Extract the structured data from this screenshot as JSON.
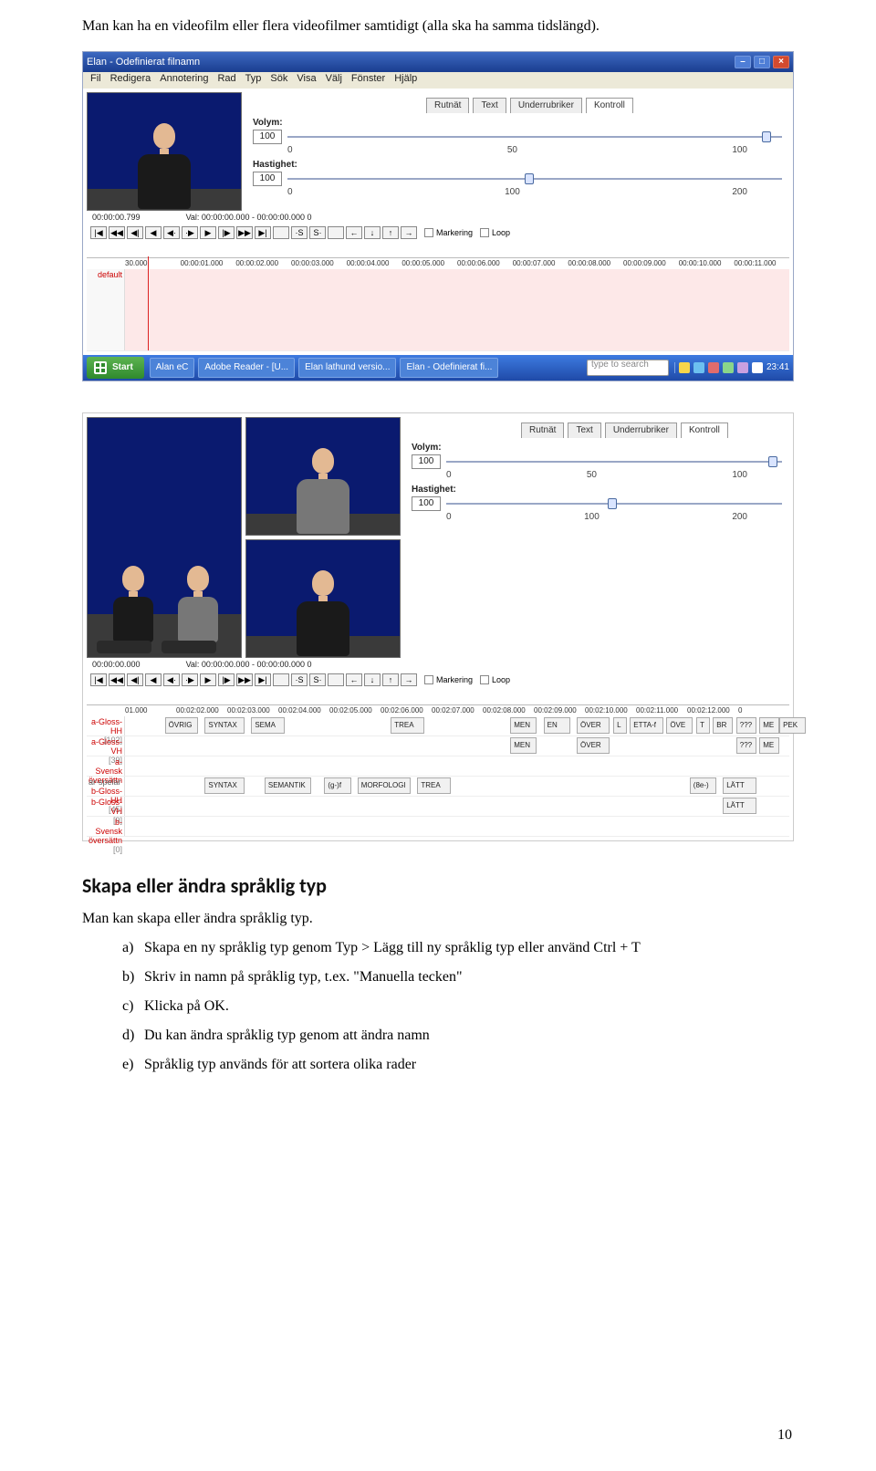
{
  "introText": "Man kan ha en videofilm eller flera videofilmer samtidigt (alla ska ha samma tidslängd).",
  "app1": {
    "title": "Elan - Odefinierat filnamn",
    "menu": [
      "Fil",
      "Redigera",
      "Annotering",
      "Rad",
      "Typ",
      "Sök",
      "Visa",
      "Välj",
      "Fönster",
      "Hjälp"
    ],
    "tabs": [
      "Rutnät",
      "Text",
      "Underrubriker",
      "Kontroll"
    ],
    "volume": {
      "label": "Volym:",
      "value": "100",
      "ticks": [
        "0",
        "50",
        "100"
      ]
    },
    "speed": {
      "label": "Hastighet:",
      "value": "100",
      "ticks": [
        "0",
        "100",
        "200"
      ]
    },
    "timecodeLeft": "00:00:00.799",
    "timecodeRight": "Val: 00:00:00.000 - 00:00:00.000  0",
    "markering": "Markering",
    "loop": "Loop",
    "ruler": [
      "30.000",
      "00:00:01.000",
      "00:00:02.000",
      "00:00:03.000",
      "00:00:04.000",
      "00:00:05.000",
      "00:00:06.000",
      "00:00:07.000",
      "00:00:08.000",
      "00:00:09.000",
      "00:00:10.000",
      "00:00:11.000"
    ],
    "laneLabel": "default"
  },
  "taskbar": {
    "start": "Start",
    "items": [
      "Alan eC",
      "Adobe Reader - [U...",
      "Elan lathund versio...",
      "Elan - Odefinierat fi..."
    ],
    "searchPlaceholder": "type to search",
    "clock": "23:41"
  },
  "app2": {
    "tabs": [
      "Rutnät",
      "Text",
      "Underrubriker",
      "Kontroll"
    ],
    "volume": {
      "label": "Volym:",
      "value": "100",
      "ticks": [
        "0",
        "50",
        "100"
      ]
    },
    "speed": {
      "label": "Hastighet:",
      "value": "100",
      "ticks": [
        "0",
        "100",
        "200"
      ]
    },
    "timecodeLeft": "00:00:00.000",
    "timecodeRight": "Val: 00:00:00.000 - 00:00:00.000  0",
    "markering": "Markering",
    "loop": "Loop",
    "ruler": [
      "01.000",
      "00:02:02.000",
      "00:02:03.000",
      "00:02:04.000",
      "00:02:05.000",
      "00:02:06.000",
      "00:02:07.000",
      "00:02:08.000",
      "00:02:09.000",
      "00:02:10.000",
      "00:02:11.000",
      "00:02:12.000",
      "0"
    ],
    "lanes": [
      {
        "label": "a-Gloss-HH",
        "sub": "[102]",
        "segs": [
          {
            "l": 6,
            "w": 5,
            "t": "ÖVRIG"
          },
          {
            "l": 12,
            "w": 6,
            "t": "SYNTAX"
          },
          {
            "l": 19,
            "w": 5,
            "t": "SEMA"
          },
          {
            "l": 40,
            "w": 5,
            "t": "TREA"
          },
          {
            "l": 58,
            "w": 4,
            "t": "MEN"
          },
          {
            "l": 63,
            "w": 4,
            "t": "EN"
          },
          {
            "l": 68,
            "w": 5,
            "t": "ÖVER"
          },
          {
            "l": 73.5,
            "w": 2,
            "t": "L"
          },
          {
            "l": 76,
            "w": 5,
            "t": "ETTA-f"
          },
          {
            "l": 81.5,
            "w": 4,
            "t": "ÖVE"
          },
          {
            "l": 86,
            "w": 2,
            "t": "T"
          },
          {
            "l": 88.5,
            "w": 3,
            "t": "BR"
          },
          {
            "l": 92,
            "w": 3,
            "t": "???"
          },
          {
            "l": 95.5,
            "w": 3,
            "t": "ME"
          },
          {
            "l": 98.5,
            "w": 4,
            "t": "PEK"
          }
        ]
      },
      {
        "label": "a-Gloss-VH",
        "sub": "[39]",
        "segs": [
          {
            "l": 58,
            "w": 4,
            "t": "MEN"
          },
          {
            "l": 68,
            "w": 5,
            "t": "ÖVER"
          },
          {
            "l": 92,
            "w": 3,
            "t": "???"
          },
          {
            "l": 95.5,
            "w": 3,
            "t": "ME"
          }
        ]
      },
      {
        "label": "a-Svensk översättn",
        "sub": "",
        "segs": []
      },
      {
        "label": "b-Gloss-HH",
        "sub": "[45]",
        "greyLabel": "ar-spelar",
        "segs": [
          {
            "l": 12,
            "w": 6,
            "t": "SYNTAX"
          },
          {
            "l": 21,
            "w": 7,
            "t": "SEMANTIK"
          },
          {
            "l": 30,
            "w": 4,
            "t": "(g-)f"
          },
          {
            "l": 35,
            "w": 8,
            "t": "MORFOLOGI"
          },
          {
            "l": 44,
            "w": 5,
            "t": "TREA"
          },
          {
            "l": 85,
            "w": 4,
            "t": "(8e-)"
          },
          {
            "l": 90,
            "w": 5,
            "t": "LÄTT"
          }
        ]
      },
      {
        "label": "b-Gloss-VH",
        "sub": "[9]",
        "segs": [
          {
            "l": 90,
            "w": 5,
            "t": "LÄTT"
          }
        ]
      },
      {
        "label": "b-Svensk översättn",
        "sub": "[0]",
        "segs": []
      }
    ]
  },
  "section": {
    "heading": "Skapa eller ändra språklig typ",
    "para": "Man kan skapa eller ändra språklig typ.",
    "items": [
      {
        "m": "a)",
        "t": "Skapa en ny språklig typ genom Typ  > Lägg till ny språklig typ  eller använd Ctrl + T"
      },
      {
        "m": "b)",
        "t": "Skriv in namn på språklig typ, t.ex. \"Manuella tecken\""
      },
      {
        "m": "c)",
        "t": "Klicka på OK."
      },
      {
        "m": "d)",
        "t": "Du kan ändra språklig typ genom att ändra namn"
      },
      {
        "m": "e)",
        "t": "Språklig typ används för att sortera olika rader"
      }
    ]
  },
  "pageNumber": "10"
}
